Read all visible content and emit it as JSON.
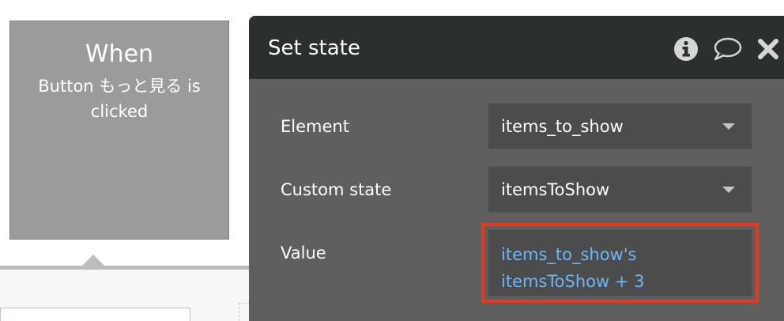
{
  "event": {
    "title": "When",
    "description": "Button もっと見る is clicked"
  },
  "panel": {
    "title": "Set state",
    "icons": [
      "info-icon",
      "comment-icon",
      "close-icon"
    ],
    "fields": {
      "element": {
        "label": "Element",
        "value": "items_to_show"
      },
      "custom_state": {
        "label": "Custom state",
        "value": "itemsToShow"
      },
      "value": {
        "label": "Value",
        "line1": "items_to_show's",
        "line2": "itemsToShow + 3"
      }
    }
  },
  "colors": {
    "panel_bg": "#5f5f5f",
    "header_bg": "#2b2f30",
    "dynamic_text": "#6eb6f5",
    "highlight": "#e8381f",
    "event_card": "#9b9b9b"
  }
}
